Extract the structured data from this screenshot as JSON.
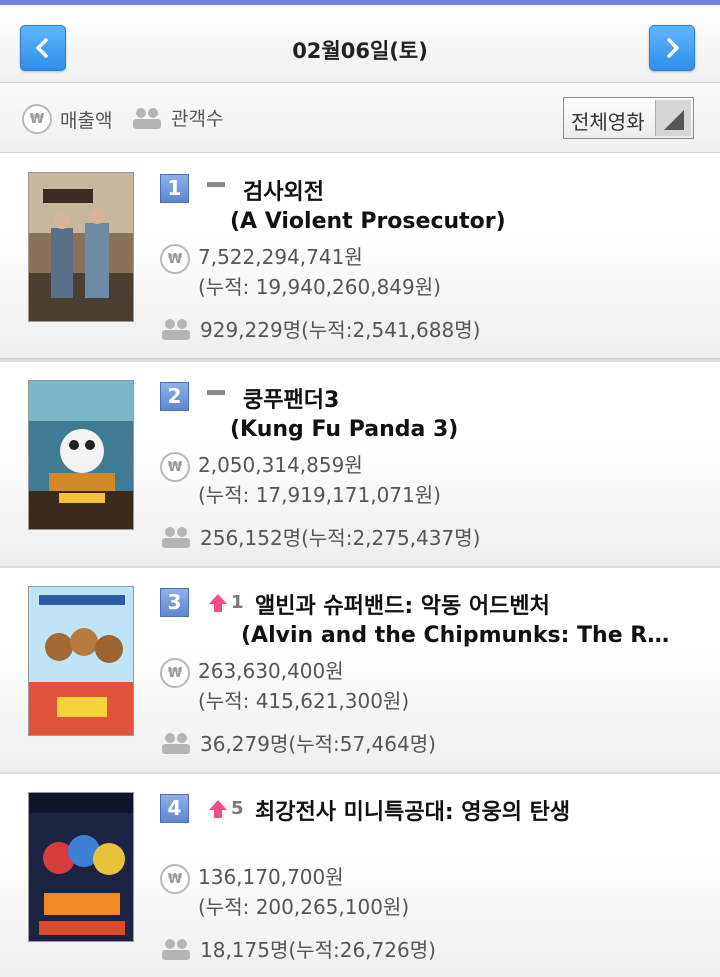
{
  "header": {
    "date": "02월06일(토)",
    "prev_icon": "chevron-left-icon",
    "next_icon": "chevron-right-icon",
    "accent_color": "#3b96f0"
  },
  "filters": {
    "sales_label": "매출액",
    "audience_label": "관객수",
    "select_value": "전체영화"
  },
  "movies": [
    {
      "rank": "1",
      "change": "same",
      "change_value": "",
      "title_ko": "검사외전",
      "title_en": "(A Violent Prosecutor)",
      "sales": "7,522,294,741원",
      "sales_total": "(누적: 19,940,260,849원)",
      "audience": "929,229명(누적:2,541,688명)"
    },
    {
      "rank": "2",
      "change": "same",
      "change_value": "",
      "title_ko": "쿵푸팬더3",
      "title_en": "(Kung Fu Panda 3)",
      "sales": "2,050,314,859원",
      "sales_total": "(누적: 17,919,171,071원)",
      "audience": "256,152명(누적:2,275,437명)"
    },
    {
      "rank": "3",
      "change": "up",
      "change_value": "1",
      "title_ko": "앨빈과 슈퍼밴드: 악동 어드벤처",
      "title_en": "(Alvin and the Chipmunks: The Road Chip)",
      "sales": "263,630,400원",
      "sales_total": "(누적: 415,621,300원)",
      "audience": "36,279명(누적:57,464명)"
    },
    {
      "rank": "4",
      "change": "up",
      "change_value": "5",
      "title_ko": "최강전사 미니특공대: 영웅의 탄생",
      "title_en": "",
      "sales": "136,170,700원",
      "sales_total": "(누적: 200,265,100원)",
      "audience": "18,175명(누적:26,726명)"
    }
  ]
}
